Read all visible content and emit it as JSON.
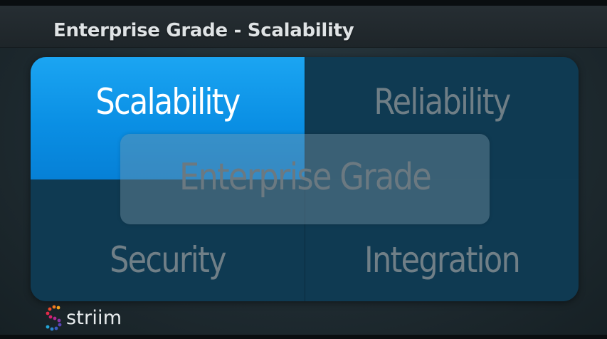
{
  "slide": {
    "title": "Enterprise Grade - Scalability"
  },
  "quadrants": [
    {
      "label": "Scalability",
      "state": "active"
    },
    {
      "label": "Reliability",
      "state": "inactive"
    },
    {
      "label": "Security",
      "state": "inactive"
    },
    {
      "label": "Integration",
      "state": "inactive"
    }
  ],
  "center": {
    "label": "Enterprise Grade"
  },
  "brand": {
    "name": "striim",
    "icon": "striim-logo-icon"
  },
  "colors": {
    "active": "#0a8fe4",
    "inactive": "#0f3a52",
    "title_text": "#dfe3e5"
  }
}
